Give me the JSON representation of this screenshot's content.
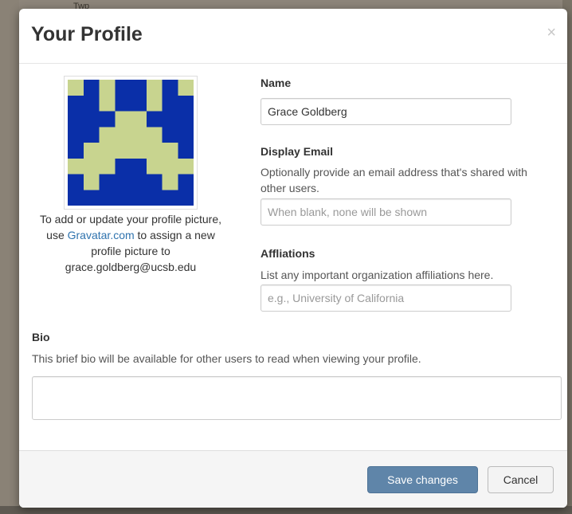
{
  "backdrop": {
    "map_label": "Twp"
  },
  "modal": {
    "title": "Your Profile",
    "close_glyph": "×"
  },
  "avatar": {
    "colors": {
      "background": "#0a2fa8",
      "pattern": "#c8d48f"
    },
    "caption_before": "To add or update your profile picture, use ",
    "caption_link": "Gravatar.com",
    "caption_after": " to assign a new profile picture to ",
    "email": "grace.goldberg@ucsb.edu"
  },
  "form": {
    "name": {
      "label": "Name",
      "value": "Grace Goldberg"
    },
    "email": {
      "label": "Display Email",
      "help": "Optionally provide an email address that's shared with other users.",
      "placeholder": "When blank, none will be shown"
    },
    "affiliations": {
      "label": "Affliations",
      "help": "List any important organization affiliations here.",
      "placeholder": "e.g., University of California"
    },
    "bio": {
      "label": "Bio",
      "help": "This brief bio will be available for other users to read when viewing your profile.",
      "value": ""
    }
  },
  "footer": {
    "save_label": "Save changes",
    "cancel_label": "Cancel"
  },
  "colors": {
    "primary_button": "#5f85a9",
    "link": "#2f73ae"
  }
}
